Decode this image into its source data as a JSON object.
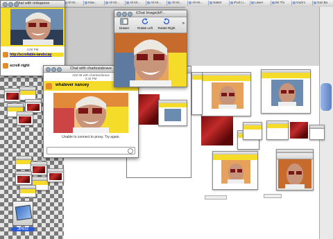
{
  "top_tabs": [
    "Flickr",
    "Ali Kit...",
    "Notabl...",
    "Ali Kit...",
    "Kaw...",
    "Ali Kit...",
    "Ali Kit...",
    "Ali Kit...",
    "Ali Kit...",
    "Ali Kit...",
    "stattet",
    "iPod Li...",
    "Lawer",
    "Bir Thi",
    "Gazini",
    "Gaz Ba"
  ],
  "chat1": {
    "title": "Chat with mrkapono",
    "time": "4:00 PM",
    "link_text": "http://scrollable-landscap",
    "scroll_text": "scroll right"
  },
  "chat2": {
    "title": "Chat with charlesisbrave",
    "sender_line": "AIM IM with charlesisbrave",
    "time": "4:40 PM",
    "header_text": "whatever nancey",
    "status": "Unable to connect to proxy. Try again."
  },
  "ichat_image": {
    "title": "iChat Image(kP...",
    "drawer_label": "Drawer",
    "rotate_left_label": "Rotate Left",
    "rotate_right_label": "Rotate Right"
  },
  "desktop_icon": {
    "label": "JPEG"
  },
  "colors": {
    "chat_yellow": "#f5dc2a",
    "link_blue": "#0000cc"
  }
}
